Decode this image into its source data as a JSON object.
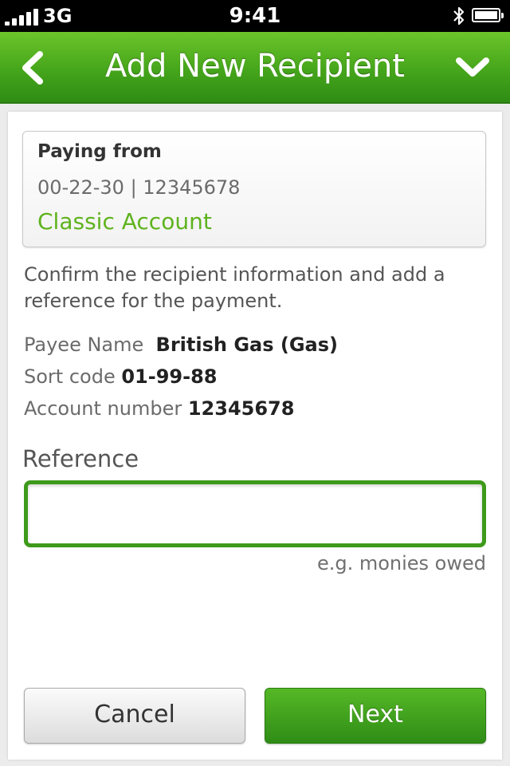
{
  "status_bar": {
    "network": "3G",
    "time": "9:41",
    "icons": [
      "signal-icon",
      "bluetooth-icon",
      "battery-icon"
    ]
  },
  "nav": {
    "title": "Add New Recipient",
    "back_icon": "chevron-left-icon",
    "menu_icon": "chevron-down-icon"
  },
  "paying_from": {
    "heading": "Paying from",
    "account_number": "00-22-30 | 12345678",
    "account_name": "Classic Account"
  },
  "instruction": "Confirm the recipient information and add a reference for the payment.",
  "recipient": {
    "payee_label": "Payee Name",
    "payee_value": "British Gas (Gas)",
    "sort_code_label": "Sort code",
    "sort_code_value": "01-99-88",
    "account_label": "Account number",
    "account_value": "12345678"
  },
  "reference": {
    "label": "Reference",
    "value": "",
    "hint": "e.g. monies owed"
  },
  "buttons": {
    "cancel": "Cancel",
    "next": "Next"
  },
  "colors": {
    "brand_green": "#45a51b",
    "account_green": "#5fb31d",
    "input_border": "#3d9a1a"
  }
}
